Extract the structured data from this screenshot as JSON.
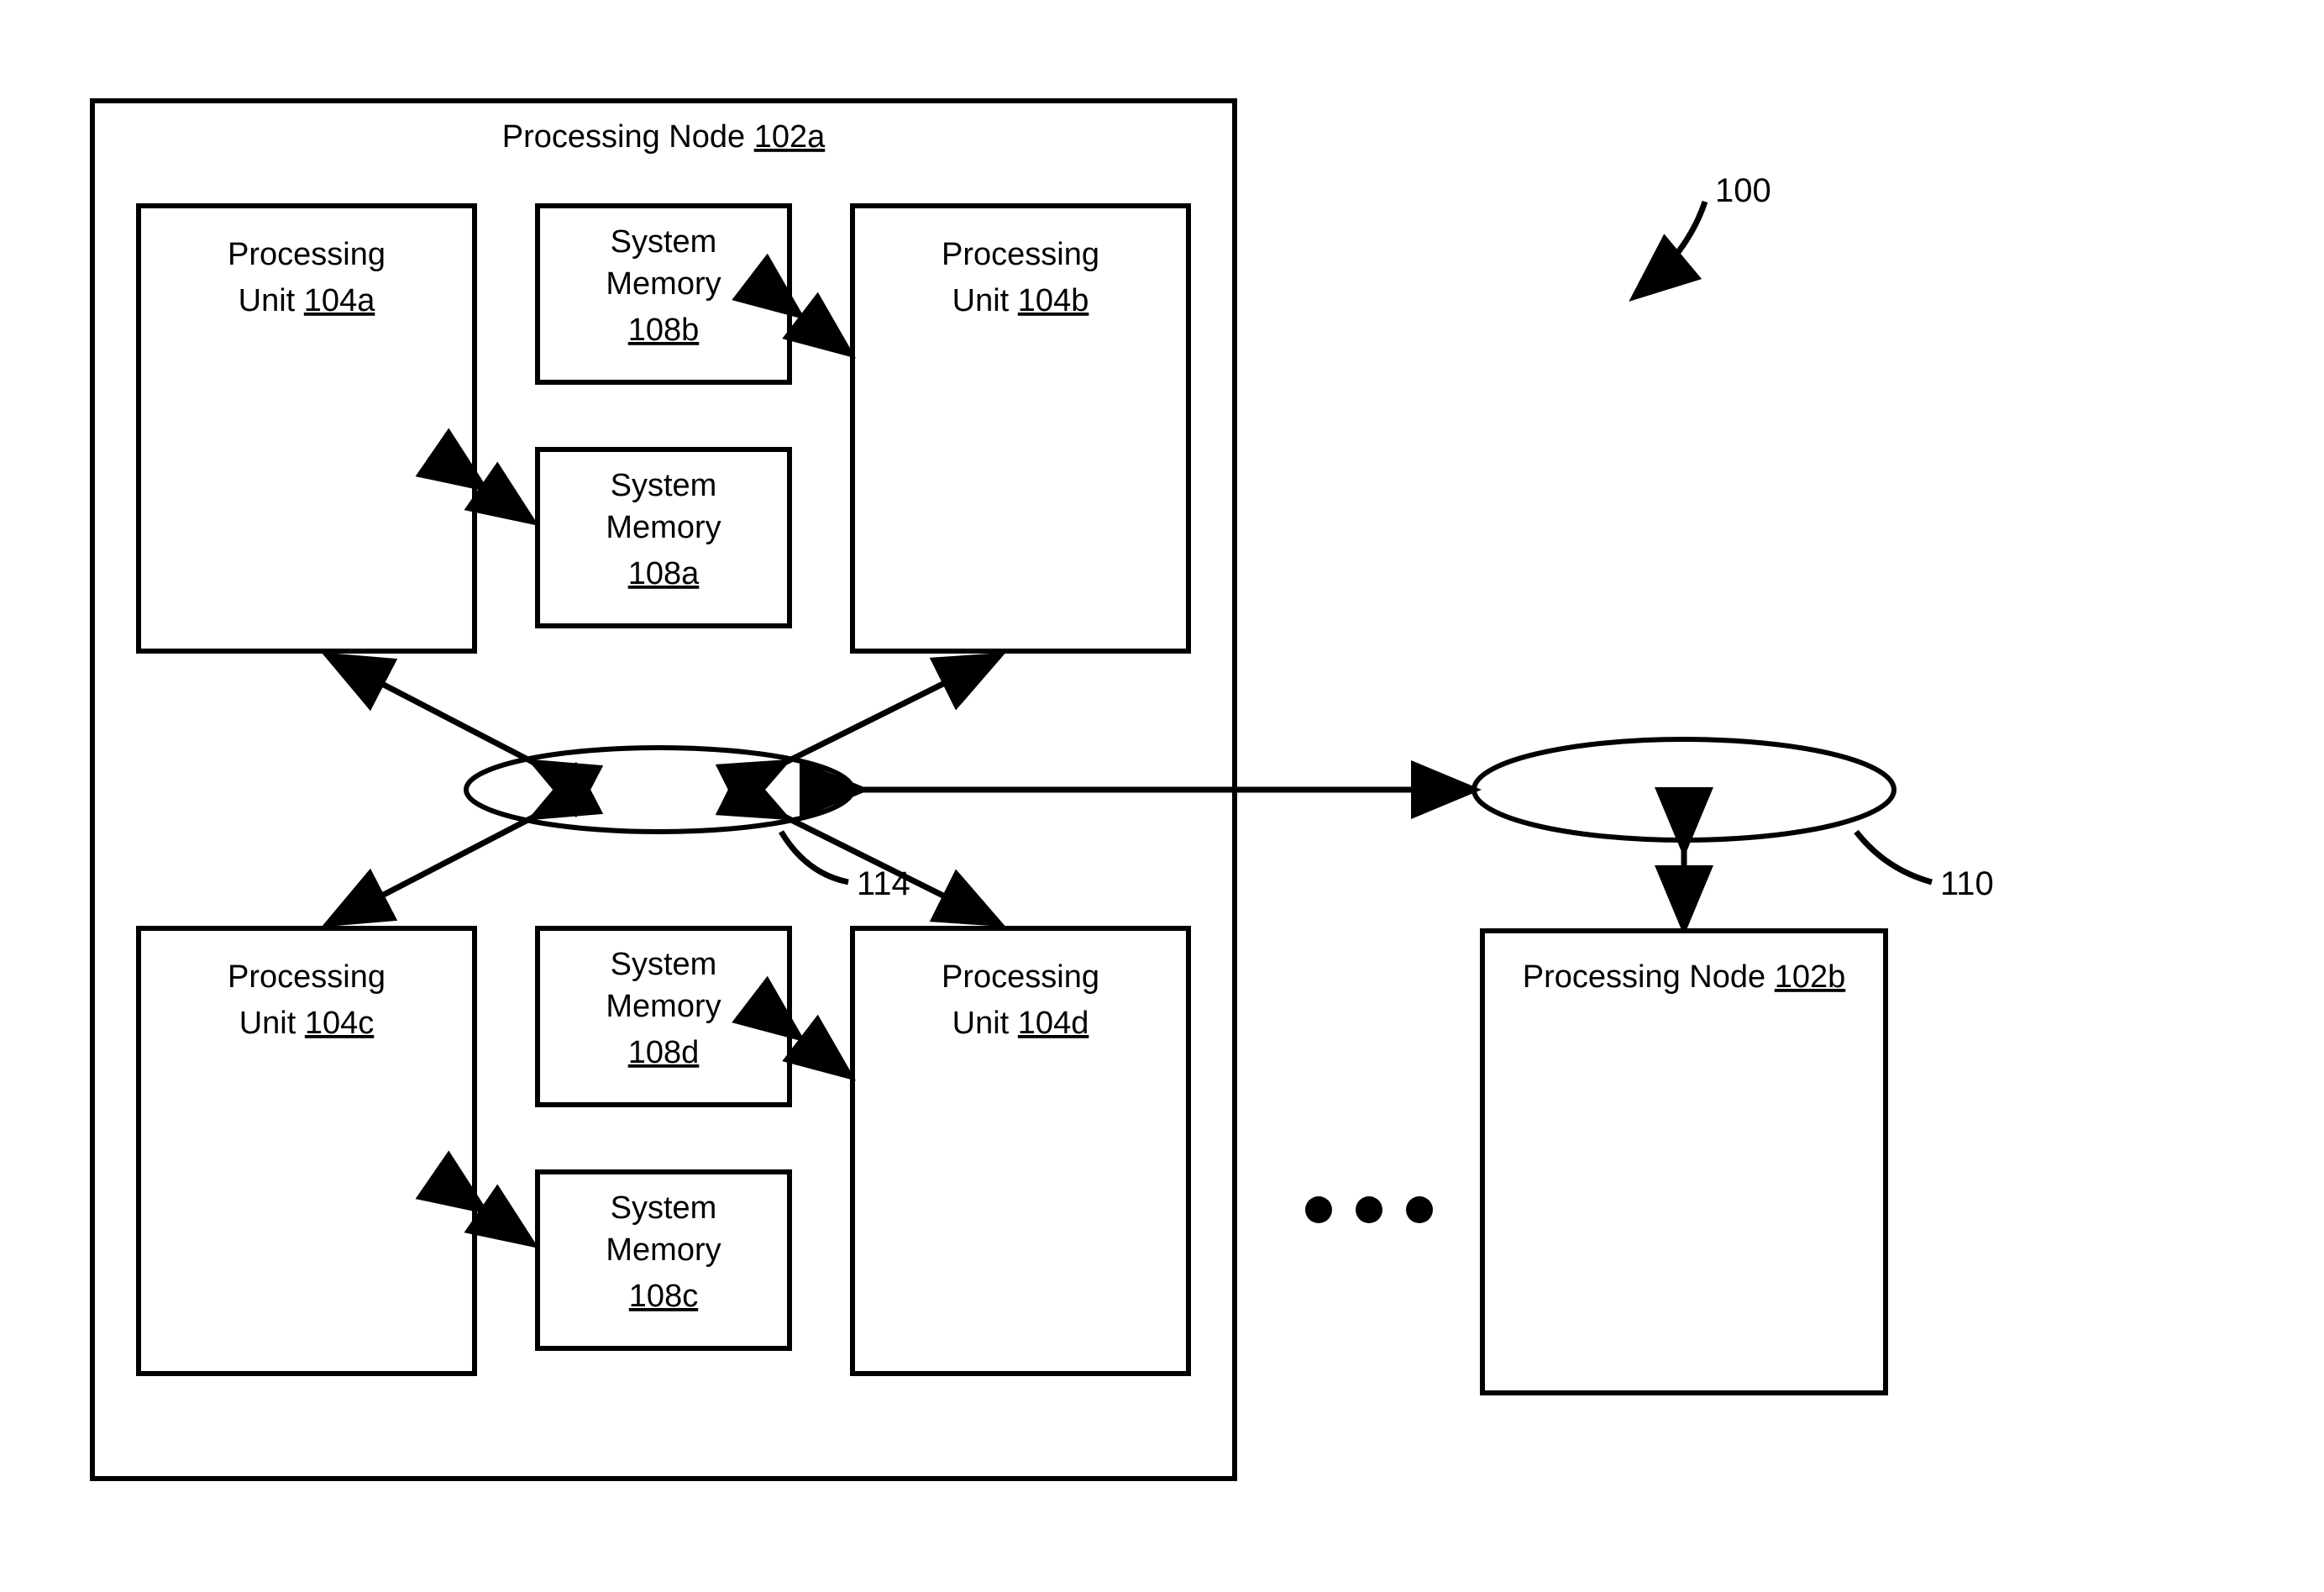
{
  "figure_label": "100",
  "nodeA": {
    "label_prefix": "Processing Node ",
    "label_id": "102a"
  },
  "nodeB": {
    "label_prefix": "Processing Node ",
    "label_id": "102b"
  },
  "units": {
    "a": {
      "line1": "Processing",
      "line2_prefix": "Unit ",
      "id": "104a"
    },
    "b": {
      "line1": "Processing",
      "line2_prefix": "Unit ",
      "id": "104b"
    },
    "c": {
      "line1": "Processing",
      "line2_prefix": "Unit ",
      "id": "104c"
    },
    "d": {
      "line1": "Processing",
      "line2_prefix": "Unit ",
      "id": "104d"
    }
  },
  "mems": {
    "a": {
      "l1": "System",
      "l2": "Memory",
      "id": "108a"
    },
    "b": {
      "l1": "System",
      "l2": "Memory",
      "id": "108b"
    },
    "c": {
      "l1": "System",
      "l2": "Memory",
      "id": "108c"
    },
    "d": {
      "l1": "System",
      "l2": "Memory",
      "id": "108d"
    }
  },
  "labels": {
    "local_fabric": "114",
    "system_fabric": "110"
  }
}
